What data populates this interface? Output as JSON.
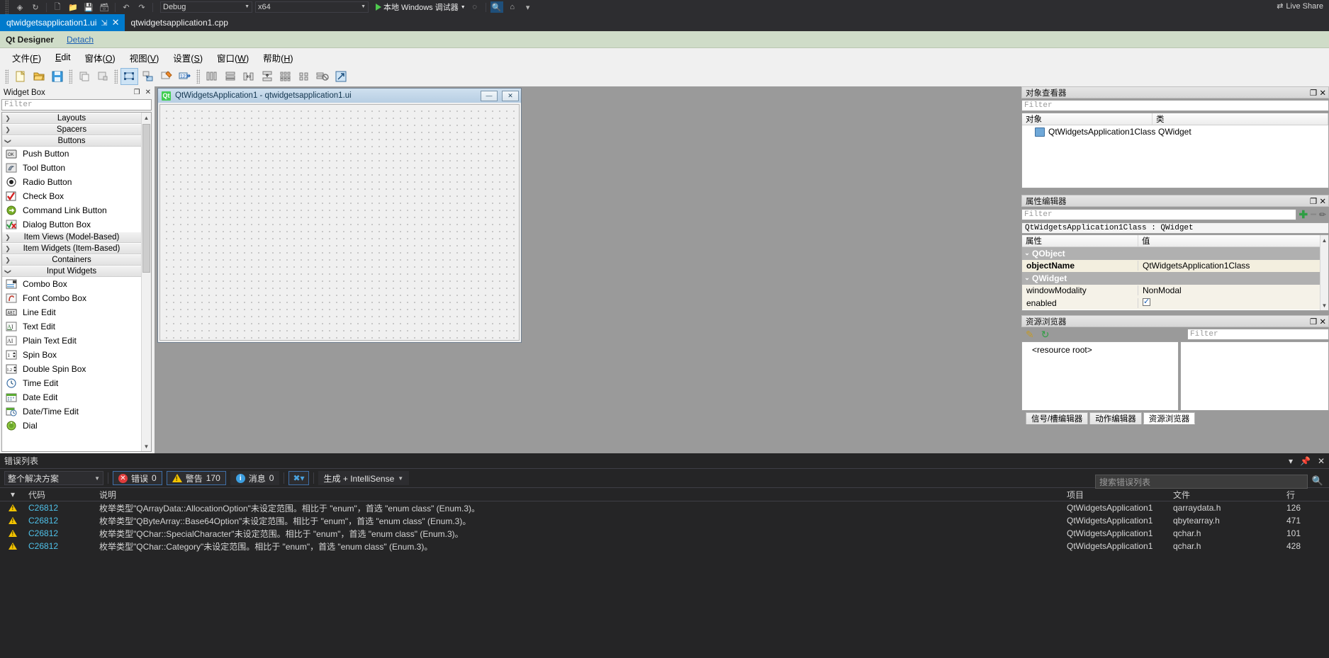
{
  "vs_toolbar": {
    "config": "Debug",
    "platform": "x64",
    "run_label": "本地 Windows 调试器",
    "live_share": "Live Share"
  },
  "tabs": [
    {
      "label": "qtwidgetsapplication1.ui",
      "active": true,
      "pin": "⇲",
      "close": "✕"
    },
    {
      "label": "qtwidgetsapplication1.cpp",
      "active": false
    }
  ],
  "qt_host": {
    "title": "Qt Designer",
    "detach": "Detach"
  },
  "qt_menu": [
    {
      "pre": "文件(",
      "key": "F",
      "post": ")"
    },
    {
      "pre": "",
      "key": "E",
      "post": "dit"
    },
    {
      "pre": "窗体(",
      "key": "O",
      "post": ")"
    },
    {
      "pre": "视图(",
      "key": "V",
      "post": ")"
    },
    {
      "pre": "设置(",
      "key": "S",
      "post": ")"
    },
    {
      "pre": "窗口(",
      "key": "W",
      "post": ")"
    },
    {
      "pre": "帮助(",
      "key": "H",
      "post": ")"
    }
  ],
  "widget_box": {
    "title": "Widget Box",
    "filter_placeholder": "Filter",
    "pin": "❐",
    "close": "✕",
    "rows": [
      {
        "kind": "cat",
        "label": "Layouts",
        "expanded": false
      },
      {
        "kind": "cat",
        "label": "Spacers",
        "expanded": false
      },
      {
        "kind": "cat",
        "label": "Buttons",
        "expanded": true
      },
      {
        "kind": "item",
        "label": "Push Button",
        "icon": "push-button-icon"
      },
      {
        "kind": "item",
        "label": "Tool Button",
        "icon": "tool-button-icon"
      },
      {
        "kind": "item",
        "label": "Radio Button",
        "icon": "radio-button-icon"
      },
      {
        "kind": "item",
        "label": "Check Box",
        "icon": "check-box-icon"
      },
      {
        "kind": "item",
        "label": "Command Link Button",
        "icon": "command-link-icon"
      },
      {
        "kind": "item",
        "label": "Dialog Button Box",
        "icon": "dialog-button-box-icon"
      },
      {
        "kind": "cat",
        "label": "Item Views (Model-Based)",
        "expanded": false
      },
      {
        "kind": "cat",
        "label": "Item Widgets (Item-Based)",
        "expanded": false
      },
      {
        "kind": "cat",
        "label": "Containers",
        "expanded": false
      },
      {
        "kind": "cat",
        "label": "Input Widgets",
        "expanded": true
      },
      {
        "kind": "item",
        "label": "Combo Box",
        "icon": "combo-box-icon"
      },
      {
        "kind": "item",
        "label": "Font Combo Box",
        "icon": "font-combo-box-icon"
      },
      {
        "kind": "item",
        "label": "Line Edit",
        "icon": "line-edit-icon"
      },
      {
        "kind": "item",
        "label": "Text Edit",
        "icon": "text-edit-icon"
      },
      {
        "kind": "item",
        "label": "Plain Text Edit",
        "icon": "plain-text-edit-icon"
      },
      {
        "kind": "item",
        "label": "Spin Box",
        "icon": "spin-box-icon"
      },
      {
        "kind": "item",
        "label": "Double Spin Box",
        "icon": "double-spin-box-icon"
      },
      {
        "kind": "item",
        "label": "Time Edit",
        "icon": "time-edit-icon"
      },
      {
        "kind": "item",
        "label": "Date Edit",
        "icon": "date-edit-icon"
      },
      {
        "kind": "item",
        "label": "Date/Time Edit",
        "icon": "date-time-edit-icon"
      },
      {
        "kind": "item",
        "label": "Dial",
        "icon": "dial-icon"
      }
    ]
  },
  "form": {
    "title": "QtWidgetsApplication1 - qtwidgetsapplication1.ui",
    "logo": "Qt",
    "minimize": "—",
    "close": "✕"
  },
  "object_inspector": {
    "title": "对象查看器",
    "filter_placeholder": "Filter",
    "pin": "❐",
    "close": "✕",
    "columns": [
      "对象",
      "类"
    ],
    "rows": [
      {
        "object": "QtWidgetsApplication1Class",
        "class": "QWidget"
      }
    ]
  },
  "property_editor": {
    "title": "属性编辑器",
    "filter_placeholder": "Filter",
    "pin": "❐",
    "close": "✕",
    "subject": "QtWidgetsApplication1Class : QWidget",
    "columns": [
      "属性",
      "值"
    ],
    "rows": [
      {
        "type": "group",
        "name": "QObject"
      },
      {
        "type": "prop",
        "name": "objectName",
        "value": "QtWidgetsApplication1Class",
        "bold": true
      },
      {
        "type": "group",
        "name": "QWidget"
      },
      {
        "type": "prop",
        "name": "windowModality",
        "value": "NonModal"
      },
      {
        "type": "prop",
        "name": "enabled",
        "value": "",
        "checkbox": true
      }
    ]
  },
  "resource_browser": {
    "title": "资源浏览器",
    "filter_placeholder": "Filter",
    "pin": "❐",
    "close": "✕",
    "root_label": "<resource root>",
    "tabs": [
      {
        "label": "信号/槽编辑器",
        "active": false
      },
      {
        "label": "动作编辑器",
        "active": false
      },
      {
        "label": "资源浏览器",
        "active": true
      }
    ]
  },
  "error_list": {
    "title": "错误列表",
    "scope": "整个解决方案",
    "counts": [
      {
        "icon": "error-icon",
        "label": "错误",
        "value": "0"
      },
      {
        "icon": "warning-icon",
        "label": "警告",
        "value": "170"
      },
      {
        "icon": "info-icon",
        "label": "消息",
        "value": "0"
      }
    ],
    "build_filter": "生成 + IntelliSense",
    "search_placeholder": "搜索错误列表",
    "columns": [
      "",
      "代码",
      "说明",
      "项目",
      "文件",
      "行"
    ],
    "rows": [
      {
        "severity": "warning",
        "code": "C26812",
        "description": "枚举类型\"QArrayData::AllocationOption\"未设定范围。相比于 \"enum\"，首选 \"enum class\" (Enum.3)。",
        "project": "QtWidgetsApplication1",
        "file": "qarraydata.h",
        "line": "126"
      },
      {
        "severity": "warning",
        "code": "C26812",
        "description": "枚举类型\"QByteArray::Base64Option\"未设定范围。相比于 \"enum\"，首选 \"enum class\" (Enum.3)。",
        "project": "QtWidgetsApplication1",
        "file": "qbytearray.h",
        "line": "471"
      },
      {
        "severity": "warning",
        "code": "C26812",
        "description": "枚举类型\"QChar::SpecialCharacter\"未设定范围。相比于 \"enum\"，首选 \"enum class\" (Enum.3)。",
        "project": "QtWidgetsApplication1",
        "file": "qchar.h",
        "line": "101"
      },
      {
        "severity": "warning",
        "code": "C26812",
        "description": "枚举类型\"QChar::Category\"未设定范围。相比于 \"enum\"，首选 \"enum class\" (Enum.3)。",
        "project": "QtWidgetsApplication1",
        "file": "qchar.h",
        "line": "428"
      }
    ]
  }
}
